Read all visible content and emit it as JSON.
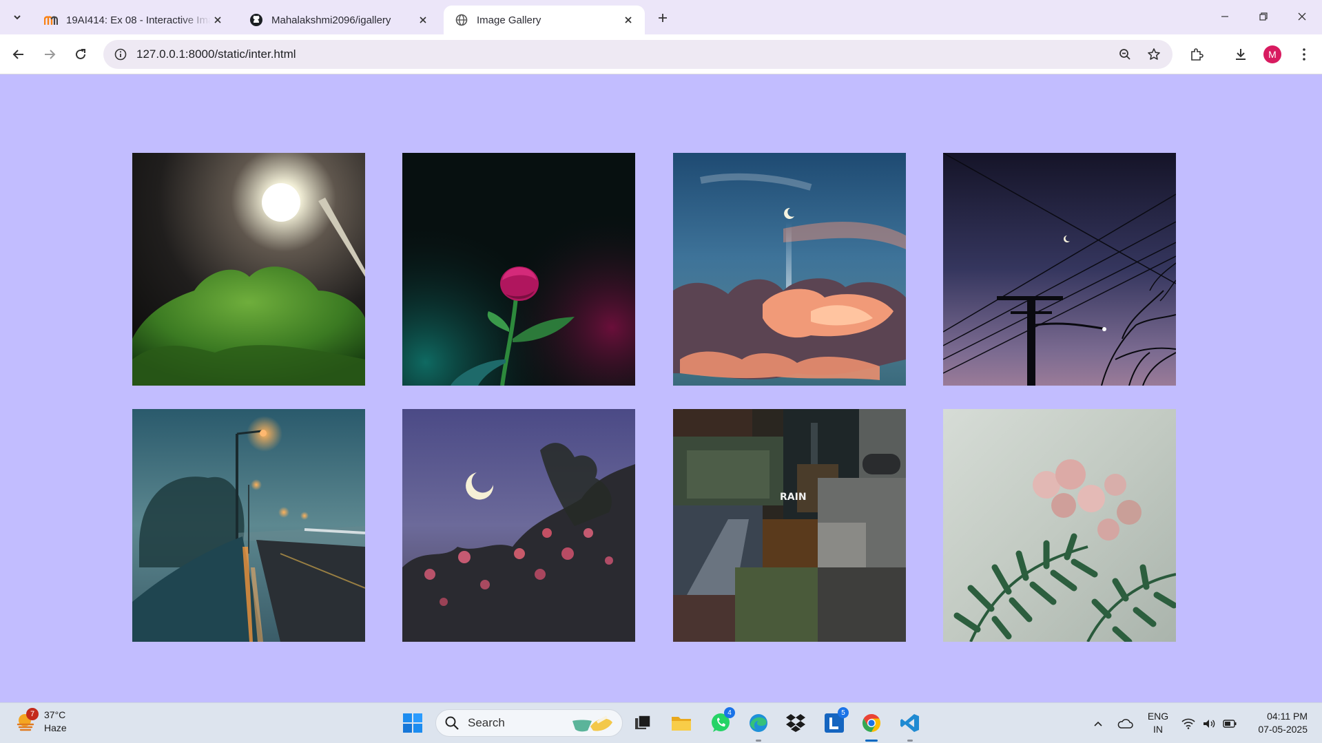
{
  "browser": {
    "tabs": [
      {
        "title": "19AI414: Ex 08 - Interactive Ima",
        "icon": "moodle-icon",
        "active": false
      },
      {
        "title": "Mahalakshmi2096/igallery",
        "icon": "github-icon",
        "active": false
      },
      {
        "title": "Image Gallery",
        "icon": "globe-icon",
        "active": true
      }
    ],
    "url": "127.0.0.1:8000/static/inter.html",
    "profile_initial": "M",
    "profile_color": "#d81b60"
  },
  "page": {
    "background": "#c2bdff",
    "gallery": [
      {
        "subject": "street lamp over green trees at night"
      },
      {
        "subject": "pink rose on dark background"
      },
      {
        "subject": "crescent moon over sunset clouds"
      },
      {
        "subject": "power lines and moon at dusk"
      },
      {
        "subject": "foggy street with lamp posts"
      },
      {
        "subject": "crescent moon over flowers"
      },
      {
        "subject": "rain collage"
      },
      {
        "subject": "flowers and fern behind rainy glass"
      }
    ]
  },
  "taskbar": {
    "weather": {
      "temp": "37°C",
      "condition": "Haze",
      "badge": "7"
    },
    "search_placeholder": "Search",
    "apps": [
      {
        "name": "task-view",
        "badge": ""
      },
      {
        "name": "file-explorer",
        "badge": ""
      },
      {
        "name": "whatsapp",
        "badge": "4"
      },
      {
        "name": "edge",
        "badge": ""
      },
      {
        "name": "dropbox",
        "badge": ""
      },
      {
        "name": "l-app",
        "badge": "5"
      },
      {
        "name": "chrome",
        "badge": ""
      },
      {
        "name": "vscode",
        "badge": ""
      }
    ],
    "language": {
      "line1": "ENG",
      "line2": "IN"
    },
    "clock": {
      "time": "04:11 PM",
      "date": "07-05-2025"
    }
  }
}
